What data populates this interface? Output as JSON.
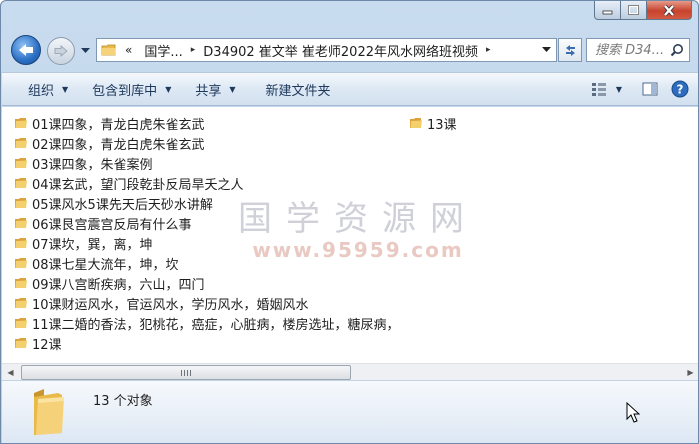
{
  "window": {
    "caption_buttons": {
      "minimize_icon": "minimize-icon",
      "maximize_icon": "maximize-icon",
      "close_icon": "close-icon"
    }
  },
  "nav": {
    "back_icon": "back-arrow-icon",
    "forward_icon": "forward-arrow-icon",
    "history_icon": "chevron-down-icon"
  },
  "address": {
    "overflow_chevron": "«",
    "crumbs": [
      "国学...",
      "D34902 崔文举 崔老师2022年风水网络班视频"
    ],
    "separator": "▸"
  },
  "search": {
    "placeholder": "搜索 D34..."
  },
  "toolbar": {
    "organize": "组织",
    "include_library": "包含到库中",
    "share": "共享",
    "new_folder": "新建文件夹",
    "view_icon": "view-options-icon",
    "preview_icon": "preview-pane-icon",
    "help_icon": "help-icon"
  },
  "files": {
    "column1": [
      "01课四象，青龙白虎朱雀玄武",
      "02课四象，青龙白虎朱雀玄武",
      "03课四象，朱雀案例",
      "04课玄武，望门段乾卦反局旱夭之人",
      "05课风水5课先天后天砂水讲解",
      "06课艮宫震宫反局有什么事",
      "07课坎，巽，离，坤",
      "08课七星大流年，坤，坎",
      "09课八宫断疾病，六山，四门",
      "10课财运风水，官运风水，学历风水，婚姻风水",
      "11课二婚的香法，犯桃花，癌症，心脏病，楼房选址，糖尿病，",
      "12课"
    ],
    "column2": [
      "13课"
    ]
  },
  "watermark": {
    "title": "国学资源网",
    "url": "www.95959.com"
  },
  "details": {
    "count_text": "13 个对象"
  },
  "colors": {
    "frame": "#b9d0e8",
    "toolbar": "#dde8f4",
    "folder": "#e9b949",
    "link_text": "#1e395b"
  }
}
